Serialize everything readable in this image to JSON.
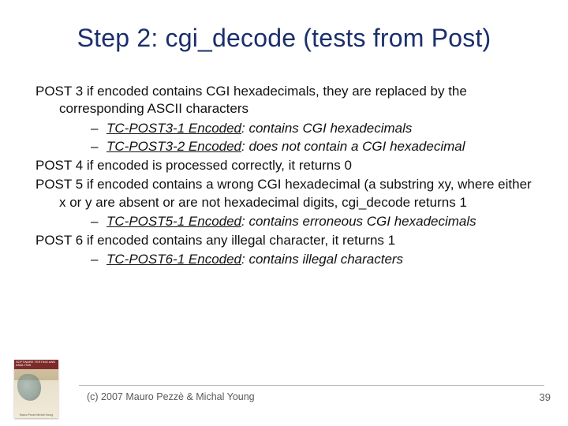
{
  "title": "Step 2: cgi_decode (tests from Post)",
  "post3": {
    "lead": "POST 3 if encoded contains CGI hexadecimals, they are replaced by the corresponding ASCII characters",
    "sub1": {
      "label": "TC-POST3-1 Encoded",
      "desc": ": contains CGI hexadecimals"
    },
    "sub2": {
      "label": "TC-POST3-2 Encoded",
      "desc": ": does not contain a CGI hexadecimal"
    }
  },
  "post4": "POST 4 if encoded is processed correctly, it returns 0",
  "post5": {
    "lead": "POST 5 if encoded contains a wrong CGI hexadecimal (a substring xy, where either x or y are absent or are not hexadecimal digits, cgi_decode returns 1",
    "sub1": {
      "label": "TC-POST5-1 Encoded",
      "desc": ": contains erroneous CGI hexadecimals"
    }
  },
  "post6": {
    "lead": "POST 6 if encoded contains any illegal character, it returns 1",
    "sub1": {
      "label": "TC-POST6-1 Encoded",
      "desc": ": contains illegal characters"
    }
  },
  "footer": {
    "copyright": "(c) 2007 Mauro Pezzè & Michal Young",
    "page": "39"
  },
  "thumb": {
    "band_text": "SOFTWARE TESTING AND ANALYSIS",
    "caption": "Mauro Pezzè  Michal Young"
  }
}
